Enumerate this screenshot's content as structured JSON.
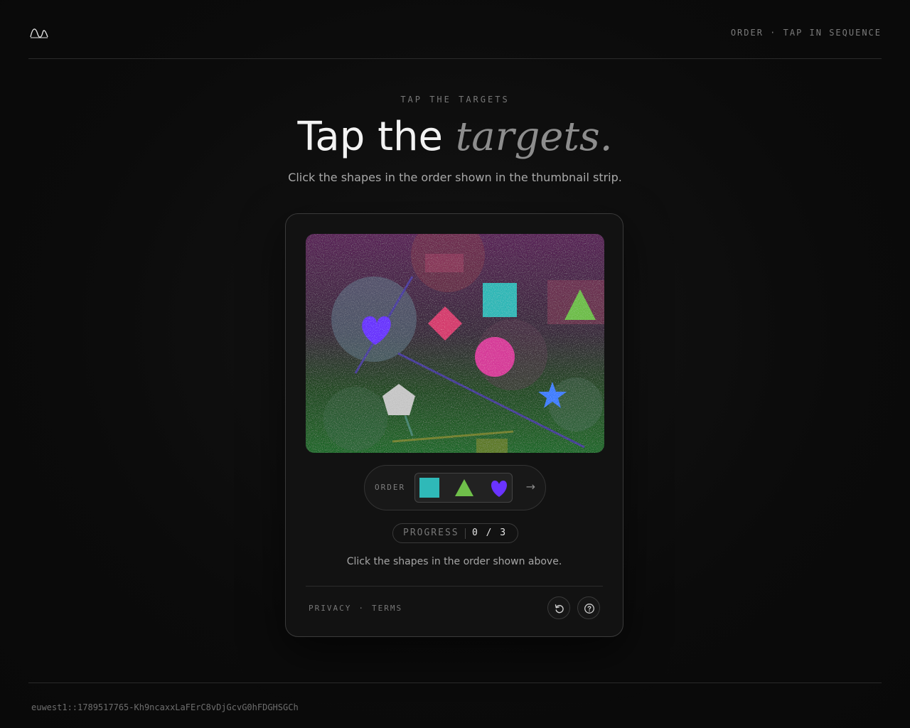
{
  "header": {
    "tag": "ORDER · TAP IN SEQUENCE"
  },
  "hero": {
    "eyebrow": "TAP THE TARGETS",
    "title_plain": "Tap the ",
    "title_emphasis": "targets.",
    "subtitle": "Click the shapes in the order shown in the thumbnail strip."
  },
  "challenge": {
    "canvas_shapes": [
      "heart",
      "diamond",
      "square",
      "triangle",
      "circle",
      "pentagon",
      "star"
    ],
    "colors": {
      "heart": "#6a33ff",
      "diamond": "#d63a6e",
      "square": "#2fb9b8",
      "triangle": "#6fbf4a",
      "circle": "#d83a9a",
      "pentagon": "#c8c8c8",
      "star": "#3f7fff"
    },
    "order": {
      "label": "ORDER",
      "sequence": [
        "square",
        "triangle",
        "heart"
      ],
      "next_arrow": "→"
    },
    "progress": {
      "label": "PROGRESS",
      "current": 0,
      "total": 3,
      "display": "0 / 3"
    },
    "instruction": "Click the shapes in the order shown above."
  },
  "card_footer": {
    "privacy": "PRIVACY",
    "separator": "·",
    "terms": "TERMS",
    "reload_icon": "reload-icon",
    "help_icon": "help-icon"
  },
  "footer": {
    "session_id": "euwest1::1789517765-Kh9ncaxxLaFErC8vDjGcvG0hFDGHSGCh"
  }
}
